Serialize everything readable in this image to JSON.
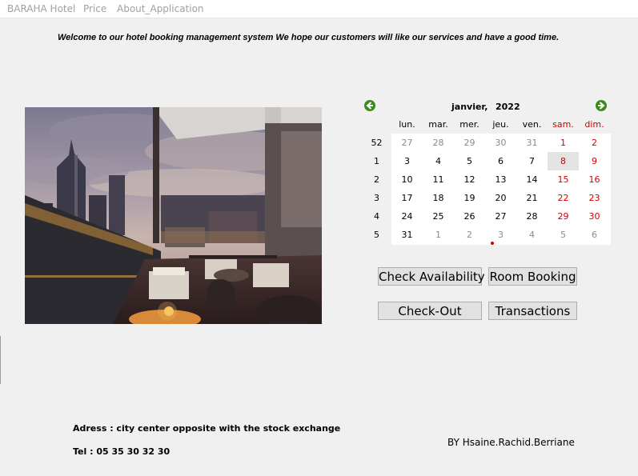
{
  "menu": [
    "BARAHA Hotel",
    "Price",
    "About_Application"
  ],
  "welcome": "Welcome to our hotel booking management system We hope our customers will like our services and have a good time.",
  "calendar": {
    "month": "janvier,",
    "year": "2022",
    "weekdays": [
      "lun.",
      "mar.",
      "mer.",
      "jeu.",
      "ven.",
      "sam.",
      "dim."
    ],
    "weeks": [
      {
        "num": "52",
        "days": [
          "27",
          "28",
          "29",
          "30",
          "31",
          "1",
          "2"
        ]
      },
      {
        "num": "1",
        "days": [
          "3",
          "4",
          "5",
          "6",
          "7",
          "8",
          "9"
        ]
      },
      {
        "num": "2",
        "days": [
          "10",
          "11",
          "12",
          "13",
          "14",
          "15",
          "16"
        ]
      },
      {
        "num": "3",
        "days": [
          "17",
          "18",
          "19",
          "20",
          "21",
          "22",
          "23"
        ]
      },
      {
        "num": "4",
        "days": [
          "24",
          "25",
          "26",
          "27",
          "28",
          "29",
          "30"
        ]
      },
      {
        "num": "5",
        "days": [
          "31",
          "1",
          "2",
          "3",
          "4",
          "5",
          "6"
        ]
      }
    ],
    "selected_day": "8",
    "weekend_color": "#d00000",
    "nav_icon_color": "#3c8a1c"
  },
  "buttons": {
    "check_availability": "Check Availability",
    "room_booking": "Room Booking",
    "check_out": "Check-Out",
    "transactions": "Transactions"
  },
  "footer": {
    "address": "Adress : city center opposite with the stock exchange",
    "tel": "Tel : 05 35 30 32 30",
    "author": "BY Hsaine.Rachid.Berriane"
  }
}
